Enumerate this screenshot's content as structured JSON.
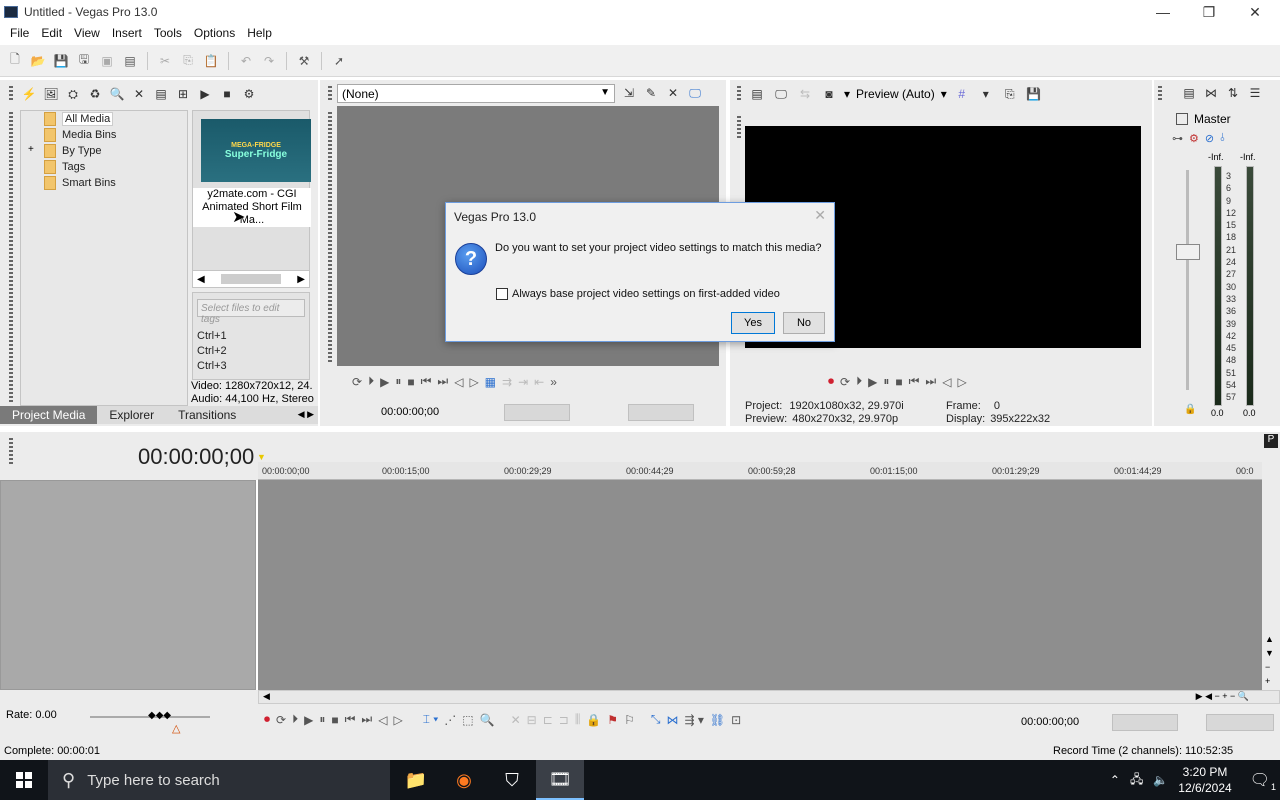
{
  "window": {
    "title": "Untitled - Vegas Pro 13.0",
    "minimize": "—",
    "maximize": "❐",
    "close": "✕"
  },
  "menu": [
    "File",
    "Edit",
    "View",
    "Insert",
    "Tools",
    "Options",
    "Help"
  ],
  "project_media": {
    "tree": [
      "All Media",
      "Media Bins",
      "By Type",
      "Tags",
      "Smart Bins"
    ],
    "expander": "+",
    "media_caption_1": "y2mate.com - CGI",
    "media_caption_2": "Animated Short Film Ma...",
    "thumb_text_top": "MEGA-FRIDGE",
    "thumb_text_main": "Super-Fridge",
    "tag_placeholder": "Select files to edit tags",
    "tag_shortcuts": [
      "Ctrl+1",
      "Ctrl+2",
      "Ctrl+3"
    ],
    "video_info": "Video: 1280x720x12, 24.",
    "audio_info": "Audio: 44,100 Hz, Stereo",
    "tabs": [
      "Project Media",
      "Explorer",
      "Transitions"
    ]
  },
  "trimmer": {
    "combo_value": "(None)",
    "timecode": "00:00:00;00"
  },
  "preview": {
    "mode": "Preview (Auto)",
    "project_label": "Project:",
    "project_value": "1920x1080x32, 29.970i",
    "preview_label": "Preview:",
    "preview_value": "480x270x32, 29.970p",
    "frame_label": "Frame:",
    "frame_value": "0",
    "display_label": "Display:",
    "display_value": "395x222x32"
  },
  "mixer": {
    "title": "Master",
    "inf_left": "-Inf.",
    "inf_right": "-Inf.",
    "scale": [
      "3",
      "6",
      "9",
      "12",
      "15",
      "18",
      "21",
      "24",
      "27",
      "30",
      "33",
      "36",
      "39",
      "42",
      "45",
      "48",
      "51",
      "54",
      "57"
    ],
    "bottom_left": "0.0",
    "bottom_right": "0.0"
  },
  "timeline": {
    "timecode": "00:00:00;00",
    "ruler": [
      "00:00:00;00",
      "00:00:15;00",
      "00:00:29;29",
      "00:00:44;29",
      "00:00:59;28",
      "00:01:15;00",
      "00:01:29;29",
      "00:01:44;29",
      "00:0"
    ],
    "rate": "Rate: 0.00",
    "end_timecode": "00:00:00;00",
    "status_left": "Complete: 00:00:01",
    "status_right": "Record Time (2 channels): 110:52:35"
  },
  "dialog": {
    "title": "Vegas Pro 13.0",
    "icon": "?",
    "message": "Do you want to set your project video settings to match this media?",
    "checkbox_label": "Always base project video settings on first-added video",
    "yes": "Yes",
    "no": "No",
    "close": "✕"
  },
  "taskbar": {
    "search_placeholder": "Type here to search",
    "time": "3:20 PM",
    "date": "12/6/2024",
    "notif_count": "1"
  }
}
